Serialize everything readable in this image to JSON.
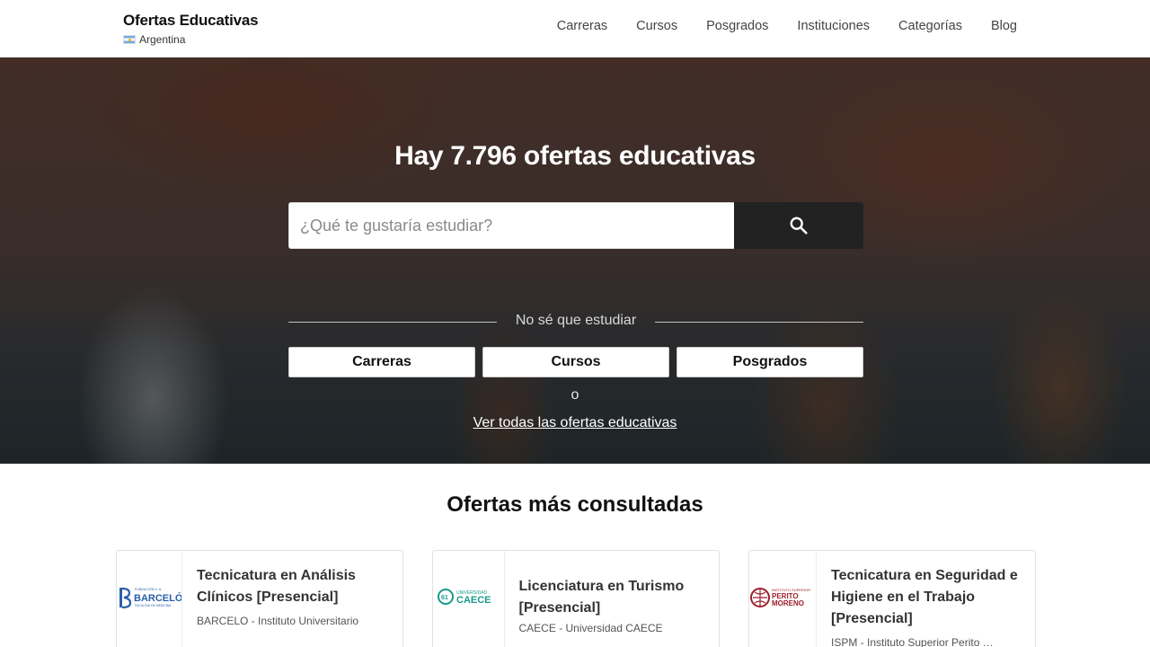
{
  "header": {
    "brand_title": "Ofertas Educativas",
    "country": "Argentina",
    "nav": [
      "Carreras",
      "Cursos",
      "Posgrados",
      "Instituciones",
      "Categorías",
      "Blog"
    ]
  },
  "hero": {
    "title": "Hay 7.796 ofertas educativas",
    "search_placeholder": "¿Qué te gustaría estudiar?",
    "divider_text": "No sé que estudiar",
    "category_buttons": [
      "Carreras",
      "Cursos",
      "Posgrados"
    ],
    "or_text": "o",
    "all_link": "Ver todas las ofertas educativas"
  },
  "featured": {
    "title": "Ofertas más consultadas",
    "cards": [
      {
        "title": "Tecnicatura en Análisis Clínicos [Presencial]",
        "institution": "BARCELO - Instituto Universitario",
        "logo_text": "BARCELÓ",
        "logo_small": "FUNDACIÓN H. A.",
        "logo_sub": "FACULTAD DE MEDICINA",
        "logo_color": "#2a5fa8"
      },
      {
        "title": "Licenciatura en Turismo [Presencial]",
        "institution": "CAECE - Universidad CAECE",
        "logo_text": "CAECE",
        "logo_small": "UNIVERSIDAD",
        "logo_color": "#1a9a8a"
      },
      {
        "title": "Tecnicatura en Seguridad e Higiene en el Trabajo [Presencial]",
        "institution": "ISPM - Instituto Superior Perito Moreno",
        "logo_text": "PERITO MORENO",
        "logo_small": "INSTITUTO SUPERIOR",
        "logo_color": "#9c1f2b"
      }
    ]
  }
}
